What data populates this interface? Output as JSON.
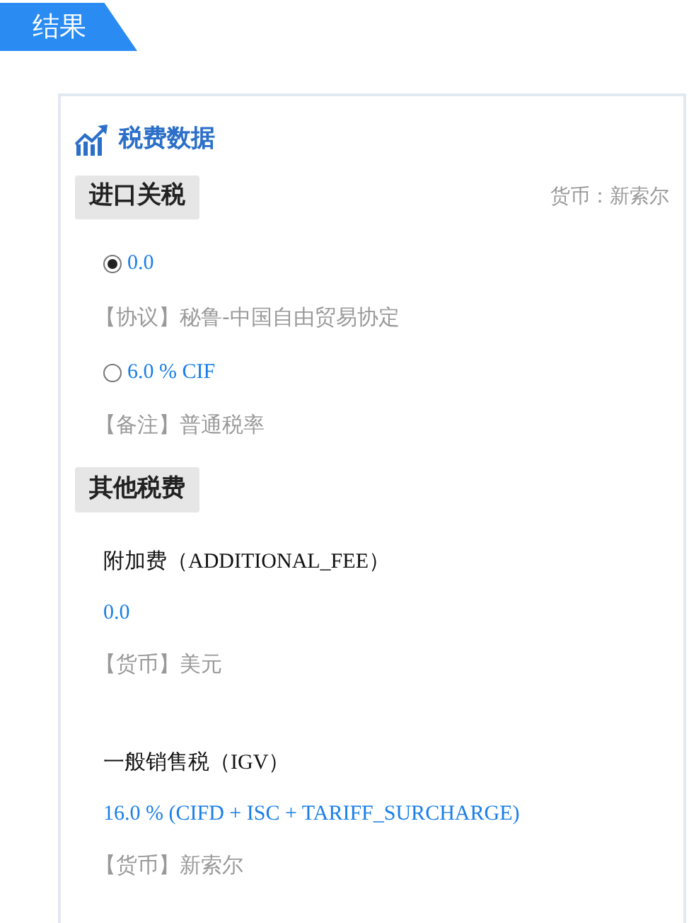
{
  "result_tab": {
    "label": "结果"
  },
  "card": {
    "title": "税费数据",
    "import_tariff": {
      "heading": "进口关税",
      "currency": "货币：新索尔",
      "options": [
        {
          "value": "0.0",
          "note": "【协议】秘鲁-中国自由贸易协定",
          "selected": true
        },
        {
          "value": "6.0 % CIF",
          "note": "【备注】普通税率",
          "selected": false
        }
      ]
    },
    "other_fees": {
      "heading": "其他税费",
      "items": [
        {
          "name": "附加费（ADDITIONAL_FEE）",
          "value": "0.0",
          "note": "【货币】美元"
        },
        {
          "name": "一般销售税（IGV）",
          "value": "16.0 % (CIFD + ISC + TARIFF_SURCHARGE)",
          "note": "【货币】新索尔"
        }
      ]
    }
  }
}
